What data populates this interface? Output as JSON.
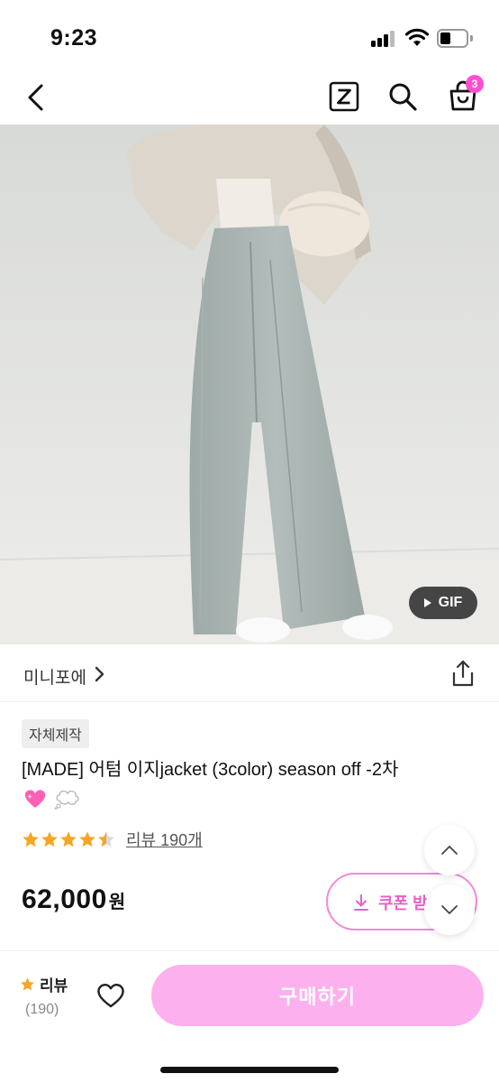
{
  "status_bar": {
    "time": "9:23"
  },
  "nav": {
    "badge_count": "3",
    "icons": [
      "back-icon",
      "zigzag-z-icon",
      "search-icon",
      "shopping-bag-icon"
    ]
  },
  "image": {
    "gif_label": "GIF"
  },
  "store": {
    "name": "미니포에"
  },
  "product": {
    "badge": "자체제작",
    "title": "[MADE] 어텀 이지jacket (3color) season off -2차",
    "rating_stars": 4.5,
    "review_link": "리뷰 190개",
    "price": "62,000",
    "price_unit": "원"
  },
  "coupon": {
    "label": "쿠폰 받"
  },
  "bottom_bar": {
    "review_label": "리뷰",
    "review_count": "(190)",
    "buy_label": "구매하기"
  },
  "colors": {
    "accent_pink": "#ff4fd0",
    "buy_button": "#fdb0ee",
    "coupon_border": "#f08ad9",
    "star": "#f6a623"
  }
}
